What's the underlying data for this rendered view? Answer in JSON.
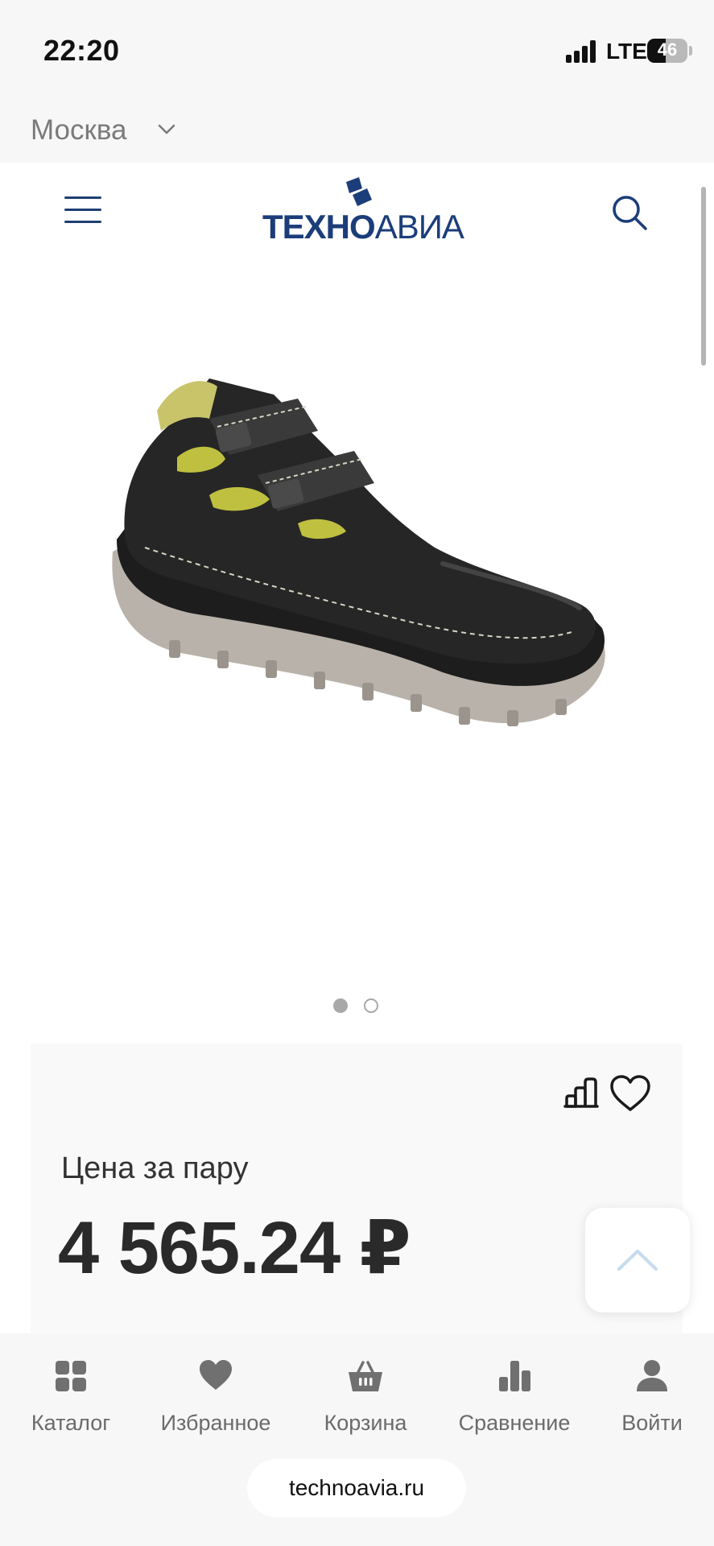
{
  "status_bar": {
    "time": "22:20",
    "network": "LTE",
    "battery": "46",
    "battery_level": 0.46
  },
  "city_bar": {
    "city": "Москва"
  },
  "header": {
    "logo_part1": "ТЕХНО",
    "logo_part2": "АВИА"
  },
  "gallery": {
    "slide_count": 2,
    "active_slide": 1
  },
  "price_card": {
    "price_label": "Цена за пару",
    "price": "4 565.24 ₽"
  },
  "bottom_nav": {
    "items": [
      {
        "label": "Каталог",
        "icon": "catalog-grid-icon"
      },
      {
        "label": "Избранное",
        "icon": "heart-icon"
      },
      {
        "label": "Корзина",
        "icon": "basket-icon"
      },
      {
        "label": "Сравнение",
        "icon": "compare-bars-icon"
      },
      {
        "label": "Войти",
        "icon": "user-icon"
      }
    ]
  },
  "browser": {
    "url": "technoavia.ru"
  },
  "colors": {
    "brand_blue": "#1b3d7a",
    "text_dark": "#2a2a2a",
    "muted": "#6b6b6b"
  }
}
